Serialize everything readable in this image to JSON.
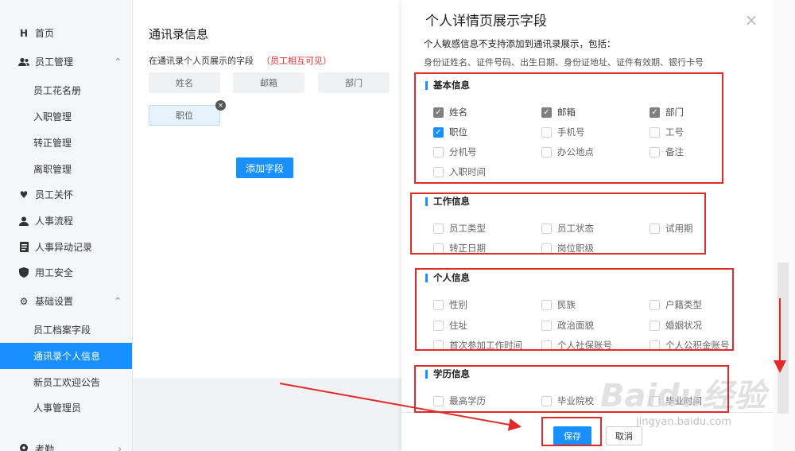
{
  "sidebar": {
    "items": [
      {
        "label": "首页",
        "icon": "home-icon",
        "glyph": "H"
      },
      {
        "label": "员工管理",
        "icon": "users-icon",
        "glyph": "👥",
        "chev": "^"
      },
      {
        "label": "员工关怀",
        "icon": "heart-icon",
        "glyph": "♥"
      },
      {
        "label": "人事流程",
        "icon": "person-icon",
        "glyph": "👤"
      },
      {
        "label": "人事异动记录",
        "icon": "document-icon",
        "glyph": "▤"
      },
      {
        "label": "用工安全",
        "icon": "shield-icon",
        "glyph": "⛉"
      },
      {
        "label": "基础设置",
        "icon": "gear-icon",
        "glyph": "⚙",
        "chev": "^"
      },
      {
        "label": "考勤",
        "icon": "location-icon",
        "glyph": "●",
        "chev": ">"
      }
    ],
    "sub_employee": [
      "员工花名册",
      "入职管理",
      "转正管理",
      "离职管理"
    ],
    "sub_settings": [
      "员工档案字段",
      "通讯录个人信息",
      "新员工欢迎公告",
      "人事管理员"
    ]
  },
  "main": {
    "title": "通讯录信息",
    "hint": "在通讯录个人页展示的字段",
    "hint_red": "（员工相互可见）",
    "chips": [
      "姓名",
      "邮箱",
      "部门"
    ],
    "selected_chip": "职位",
    "chip_close": "×",
    "add_button": "添加字段"
  },
  "panel": {
    "title": "个人详情页展示字段",
    "close": "×",
    "note1": "个人敏感信息不支持添加到通讯录展示，包括：",
    "note2": "身份证姓名、证件号码、出生日期、身份证地址、证件有效期、银行卡号",
    "sections": [
      {
        "name": "基本信息",
        "items": [
          {
            "label": "姓名",
            "state": "gray"
          },
          {
            "label": "邮箱",
            "state": "gray"
          },
          {
            "label": "部门",
            "state": "gray"
          },
          {
            "label": "职位",
            "state": "blue"
          },
          {
            "label": "手机号",
            "state": "off"
          },
          {
            "label": "工号",
            "state": "off"
          },
          {
            "label": "分机号",
            "state": "off"
          },
          {
            "label": "办公地点",
            "state": "off"
          },
          {
            "label": "备注",
            "state": "off"
          },
          {
            "label": "入职时间",
            "state": "off"
          }
        ]
      },
      {
        "name": "工作信息",
        "items": [
          {
            "label": "员工类型",
            "state": "off"
          },
          {
            "label": "员工状态",
            "state": "off"
          },
          {
            "label": "试用期",
            "state": "off"
          },
          {
            "label": "转正日期",
            "state": "off"
          },
          {
            "label": "岗位职级",
            "state": "off"
          }
        ]
      },
      {
        "name": "个人信息",
        "items": [
          {
            "label": "性别",
            "state": "off"
          },
          {
            "label": "民族",
            "state": "off"
          },
          {
            "label": "户籍类型",
            "state": "off"
          },
          {
            "label": "住址",
            "state": "off"
          },
          {
            "label": "政治面貌",
            "state": "off"
          },
          {
            "label": "婚姻状况",
            "state": "off"
          },
          {
            "label": "首次参加工作时间",
            "state": "off"
          },
          {
            "label": "个人社保账号",
            "state": "off"
          },
          {
            "label": "个人公积金账号",
            "state": "off"
          }
        ]
      },
      {
        "name": "学历信息",
        "items": [
          {
            "label": "最高学历",
            "state": "off"
          },
          {
            "label": "毕业院校",
            "state": "off"
          },
          {
            "label": "毕业时间",
            "state": "off"
          }
        ]
      }
    ],
    "save": "保存",
    "cancel": "取消"
  },
  "watermark": {
    "text": "Baidu经验",
    "sub": "jingyan.baidu.com"
  },
  "colors": {
    "accent": "#1890ff",
    "annotation": "#e12a2a",
    "checked_gray": "#7f7f7f"
  }
}
